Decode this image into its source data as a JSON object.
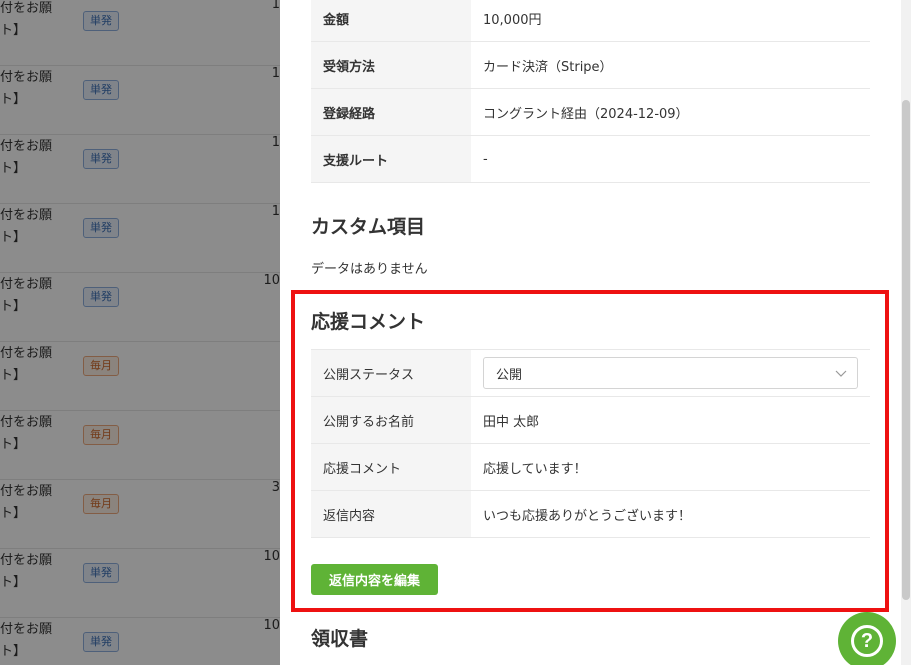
{
  "background_list": {
    "rows": [
      {
        "line1": "付をお願",
        "line2": "ト】",
        "tag": "単発",
        "tag_color": "blue",
        "amount": "1"
      },
      {
        "line1": "付をお願",
        "line2": "ト】",
        "tag": "単発",
        "tag_color": "blue",
        "amount": "1"
      },
      {
        "line1": "付をお願",
        "line2": "ト】",
        "tag": "単発",
        "tag_color": "blue",
        "amount": "1"
      },
      {
        "line1": "付をお願",
        "line2": "ト】",
        "tag": "単発",
        "tag_color": "blue",
        "amount": "1"
      },
      {
        "line1": "付をお願",
        "line2": "ト】",
        "tag": "単発",
        "tag_color": "blue",
        "amount": "10"
      },
      {
        "line1": "付をお願",
        "line2": "ト】",
        "tag": "毎月",
        "tag_color": "orange",
        "amount": ""
      },
      {
        "line1": "付をお願",
        "line2": "ト】",
        "tag": "毎月",
        "tag_color": "orange",
        "amount": ""
      },
      {
        "line1": "付をお願",
        "line2": "ト】",
        "tag": "毎月",
        "tag_color": "orange",
        "amount": "3"
      },
      {
        "line1": "付をお願",
        "line2": "ト】",
        "tag": "単発",
        "tag_color": "blue",
        "amount": "10"
      },
      {
        "line1": "付をお願",
        "line2": "ト】",
        "tag": "単発",
        "tag_color": "blue",
        "amount": "10"
      }
    ]
  },
  "details": {
    "rows": [
      {
        "key": "金額",
        "value": "10,000円"
      },
      {
        "key": "受領方法",
        "value": "カード決済（Stripe）"
      },
      {
        "key": "登録経路",
        "value": "コングラント経由（2024-12-09）"
      },
      {
        "key": "支援ルート",
        "value": "-"
      }
    ]
  },
  "custom_fields": {
    "title": "カスタム項目",
    "empty_text": "データはありません"
  },
  "support_comment": {
    "title": "応援コメント",
    "status_label": "公開ステータス",
    "status_value": "公開",
    "name_label": "公開するお名前",
    "name_value": "田中 太郎",
    "comment_label": "応援コメント",
    "comment_value": "応援しています！",
    "reply_label": "返信内容",
    "reply_value": "いつも応援ありがとうございます！",
    "edit_button": "返信内容を編集"
  },
  "receipt": {
    "title": "領収書"
  },
  "colors": {
    "accent_green": "#5fb336",
    "highlight_red": "#ee1111"
  }
}
